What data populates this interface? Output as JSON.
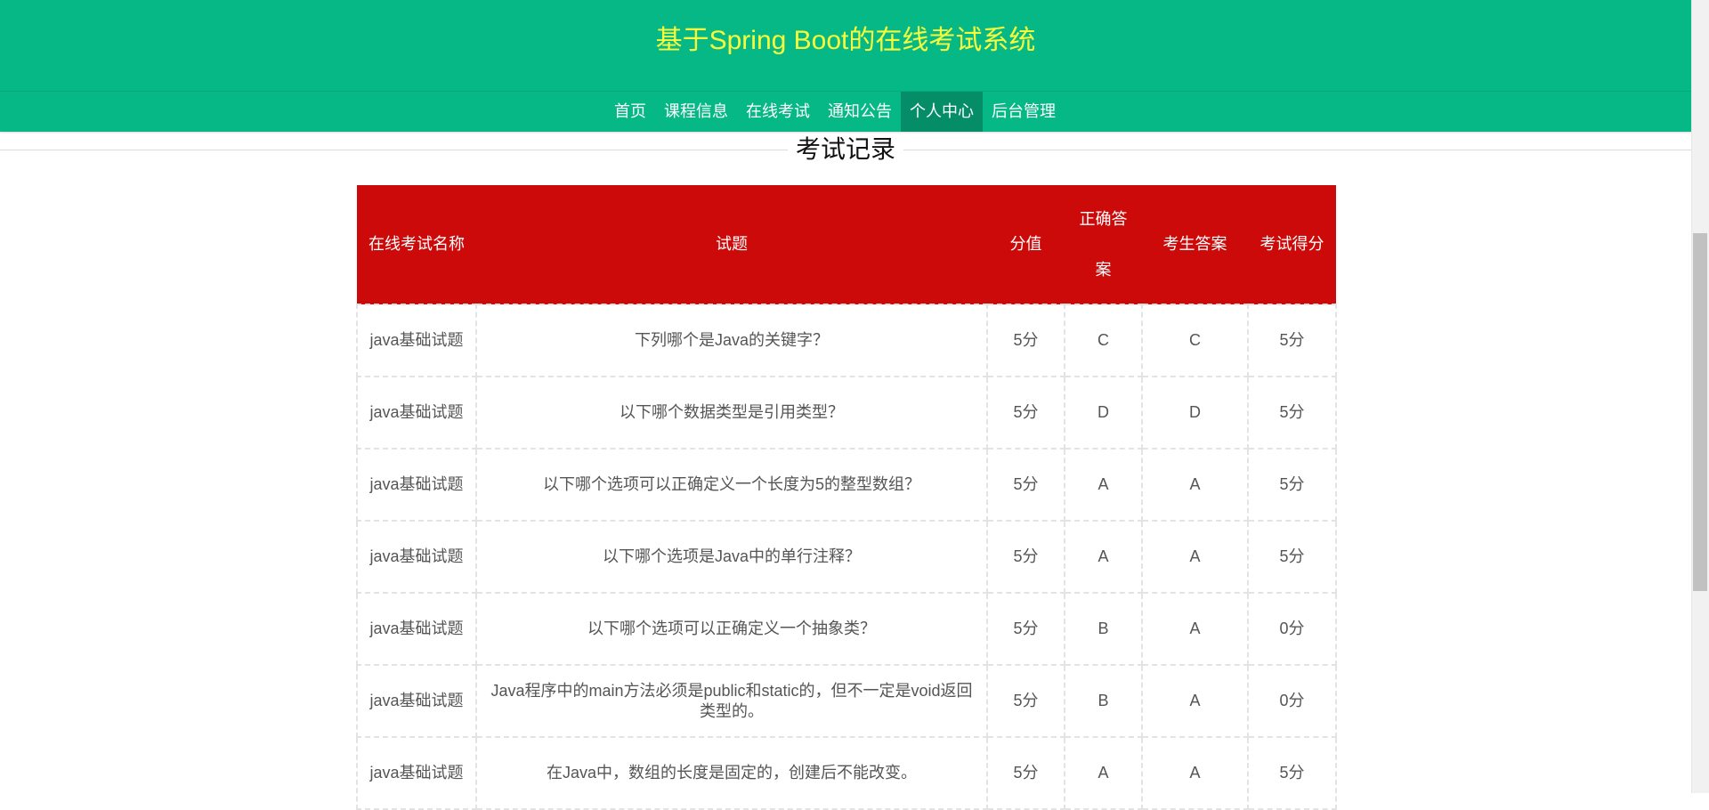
{
  "header": {
    "site_title": "基于Spring Boot的在线考试系统"
  },
  "nav": {
    "items": [
      {
        "label": "首页",
        "active": false
      },
      {
        "label": "课程信息",
        "active": false
      },
      {
        "label": "在线考试",
        "active": false
      },
      {
        "label": "通知公告",
        "active": false
      },
      {
        "label": "个人中心",
        "active": true
      },
      {
        "label": "后台管理",
        "active": false
      }
    ]
  },
  "page": {
    "title": "考试记录"
  },
  "table": {
    "headers": [
      "在线考试名称",
      "试题",
      "分值",
      "正确答案",
      "考生答案",
      "考试得分"
    ],
    "rows": [
      [
        "java基础试题",
        "下列哪个是Java的关键字？",
        "5分",
        "C",
        "C",
        "5分"
      ],
      [
        "java基础试题",
        "以下哪个数据类型是引用类型？",
        "5分",
        "D",
        "D",
        "5分"
      ],
      [
        "java基础试题",
        "以下哪个选项可以正确定义一个长度为5的整型数组？",
        "5分",
        "A",
        "A",
        "5分"
      ],
      [
        "java基础试题",
        "以下哪个选项是Java中的单行注释？",
        "5分",
        "A",
        "A",
        "5分"
      ],
      [
        "java基础试题",
        "以下哪个选项可以正确定义一个抽象类？",
        "5分",
        "B",
        "A",
        "0分"
      ],
      [
        "java基础试题",
        "Java程序中的main方法必须是public和static的，但不一定是void返回类型的。",
        "5分",
        "B",
        "A",
        "0分"
      ],
      [
        "java基础试题",
        "在Java中，数组的长度是固定的，创建后不能改变。",
        "5分",
        "A",
        "A",
        "5分"
      ]
    ]
  },
  "colors": {
    "header_bg": "#07b887",
    "title_color": "#f7ff3a",
    "nav_active_bg": "#058d68",
    "table_header_bg": "#cc0a0a"
  }
}
